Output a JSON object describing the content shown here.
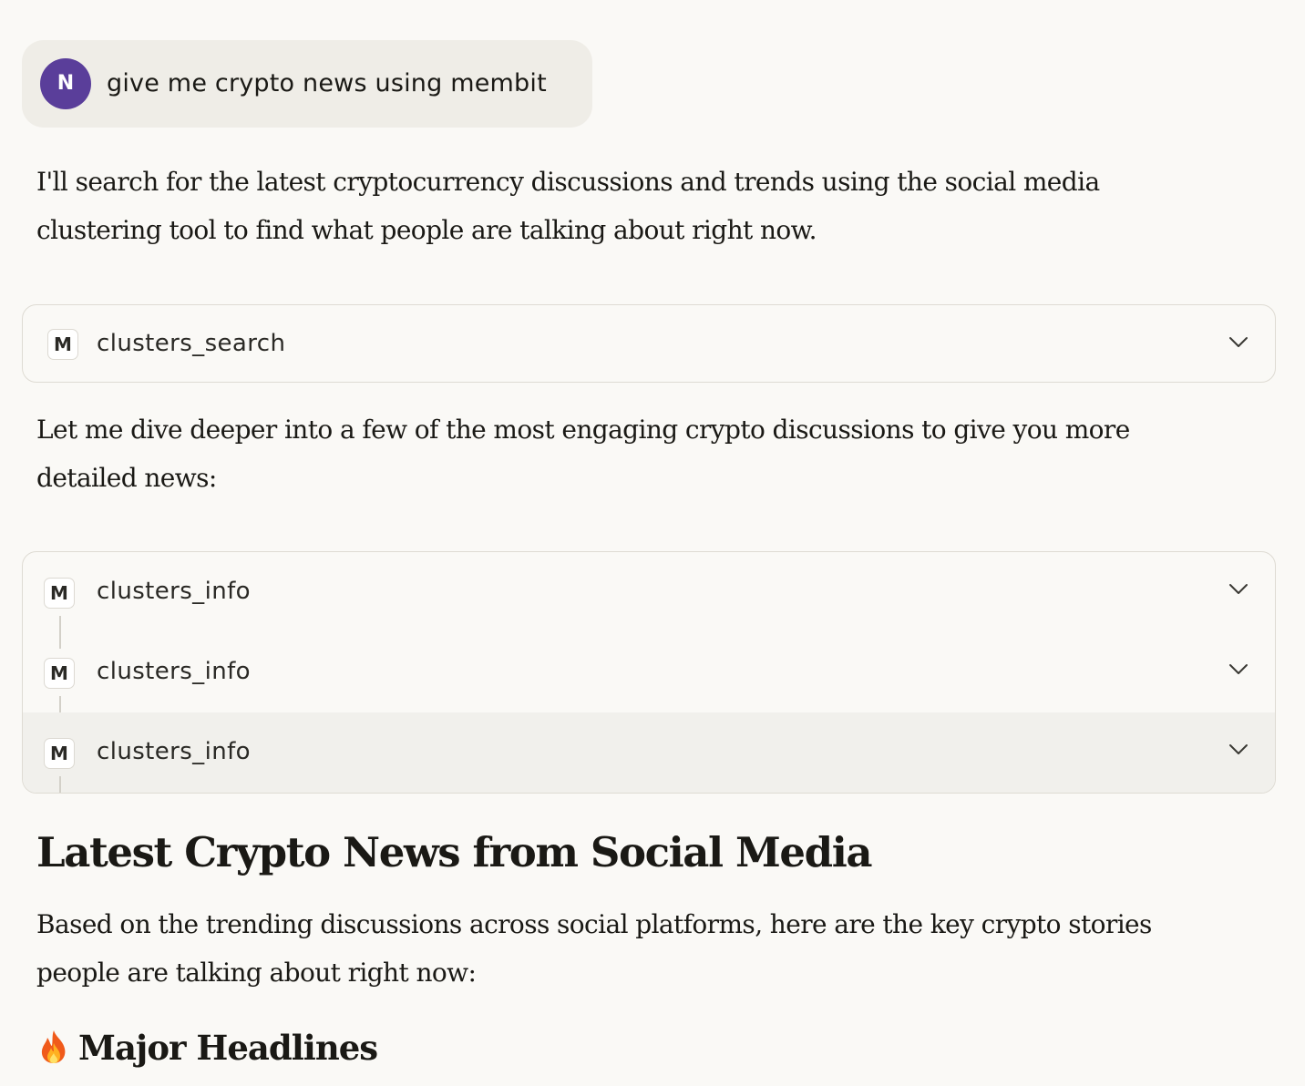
{
  "user_message": {
    "avatar_initial": "N",
    "avatar_color": "#5a3e9a",
    "text": "give me crypto news using membit"
  },
  "assistant": {
    "intro": "I'll search for the latest cryptocurrency discussions and trends using the social media clustering tool to find what people are talking about right now.",
    "tool_call_1": {
      "badge": "M",
      "name": "clusters_search",
      "expanded": false
    },
    "followup": "Let me dive deeper into a few of the most engaging crypto discussions to give you more detailed news:",
    "tool_calls_group": [
      {
        "badge": "M",
        "name": "clusters_info",
        "expanded": false
      },
      {
        "badge": "M",
        "name": "clusters_info",
        "expanded": false
      },
      {
        "badge": "M",
        "name": "clusters_info",
        "expanded": false
      }
    ],
    "heading": "Latest Crypto News from Social Media",
    "summary": "Based on the trending discussions across social platforms, here are the key crypto stories people are talking about right now:",
    "subheading": {
      "icon": "fire-icon",
      "text": "Major Headlines"
    }
  }
}
